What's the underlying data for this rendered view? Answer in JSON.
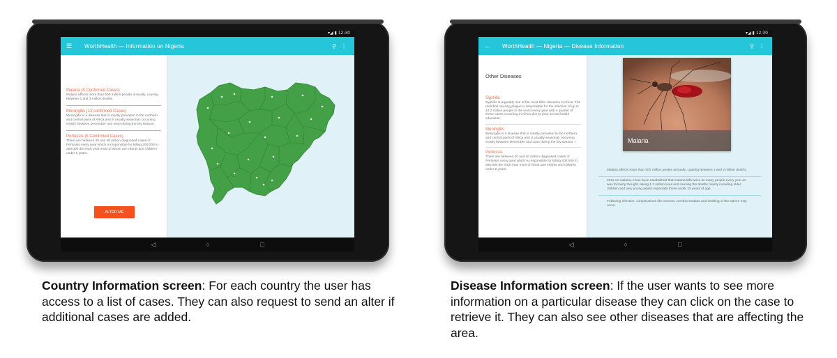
{
  "screen1": {
    "status_time": "12:30",
    "appbar_title": "WorthHealth — Information on Nigeria",
    "cases": [
      {
        "title": "Malaria (5 Confirmed Cases)",
        "desc": "Malaria affects more than 500 million people annually, causing between 1 and 3 million deaths."
      },
      {
        "title": "Meningitis (12 confirmed Cases)",
        "desc": "Meningitis is a disease that is mostly prevalent in the northern and central parts of Africa and is usually seasonal, occurring mostly between December and June during the dry season."
      },
      {
        "title": "Pertussis (8 Confirmed Cases)",
        "desc": "There are between 20 and 40 million diagnosed cases of Pertussis every year which is responsible for killing 200,000 to 300,000 die each year most of whom are infants and children under 5 years."
      }
    ],
    "alter_button": "ALTER ME"
  },
  "screen2": {
    "status_time": "12:30",
    "appbar_title": "WorthHealth — Nigeria — Disease Information",
    "other_title": "Other Diseases",
    "diseases": [
      {
        "title": "Syphilis",
        "desc": "Syphilis is arguably one of the most killer diseases in Africa. The rash/boil causing plague is responsible for the infection of up to 12.2 million people in the world every year with a quarter of these cases occurring in Africa due to poor sexual health education."
      },
      {
        "title": "Meningitis",
        "desc": "Meningitis is a disease that is mostly prevalent in the northern and central parts of Africa and is usually seasonal, occurring mostly between December and June during the dry season. I"
      },
      {
        "title": "Pertussis",
        "desc": "There are between 20 and 40 million diagnosed cases of Pertussis every year which is responsible for killing 200,000 to 300,000 die each year most of whom are infants and children under 5 years."
      }
    ],
    "photo_caption": "Malaria",
    "info": [
      "Malaria affects more than 500 million people annually, causing between 1 and 3 million deaths.",
      "2012 on malaria, it has been established that malaria kills twice as many people every year as was formerly thought, taking 1.2 million lives and causing the deaths mainly including older children and very young adults especially those under 15 years of age.",
      "Following infection, complications like anemia, cerebral malaria and swelling of the spleen may occur."
    ]
  },
  "captions": {
    "c1_bold": "Country Information screen",
    "c1_text": ": For each country the user has access to a list of cases. They can also request to send an alter if additional cases are added.",
    "c2_bold": "Disease Information screen",
    "c2_text": ": If the user wants to see more information on a particular disease they can click on the case to retrieve it. They can also see other diseases that are affecting the area."
  },
  "icons": {
    "menu": "menu-icon",
    "back": "back-arrow-icon",
    "search": "search-icon",
    "more": "more-vert-icon",
    "nav_back": "nav-back-icon",
    "nav_home": "nav-home-icon",
    "nav_recents": "nav-recents-icon"
  },
  "colors": {
    "appbar": "#26c6da",
    "accent": "#f4511e",
    "map": "#43a047",
    "panel_bg": "#e0f2f7",
    "case_title": "#e8704a"
  }
}
